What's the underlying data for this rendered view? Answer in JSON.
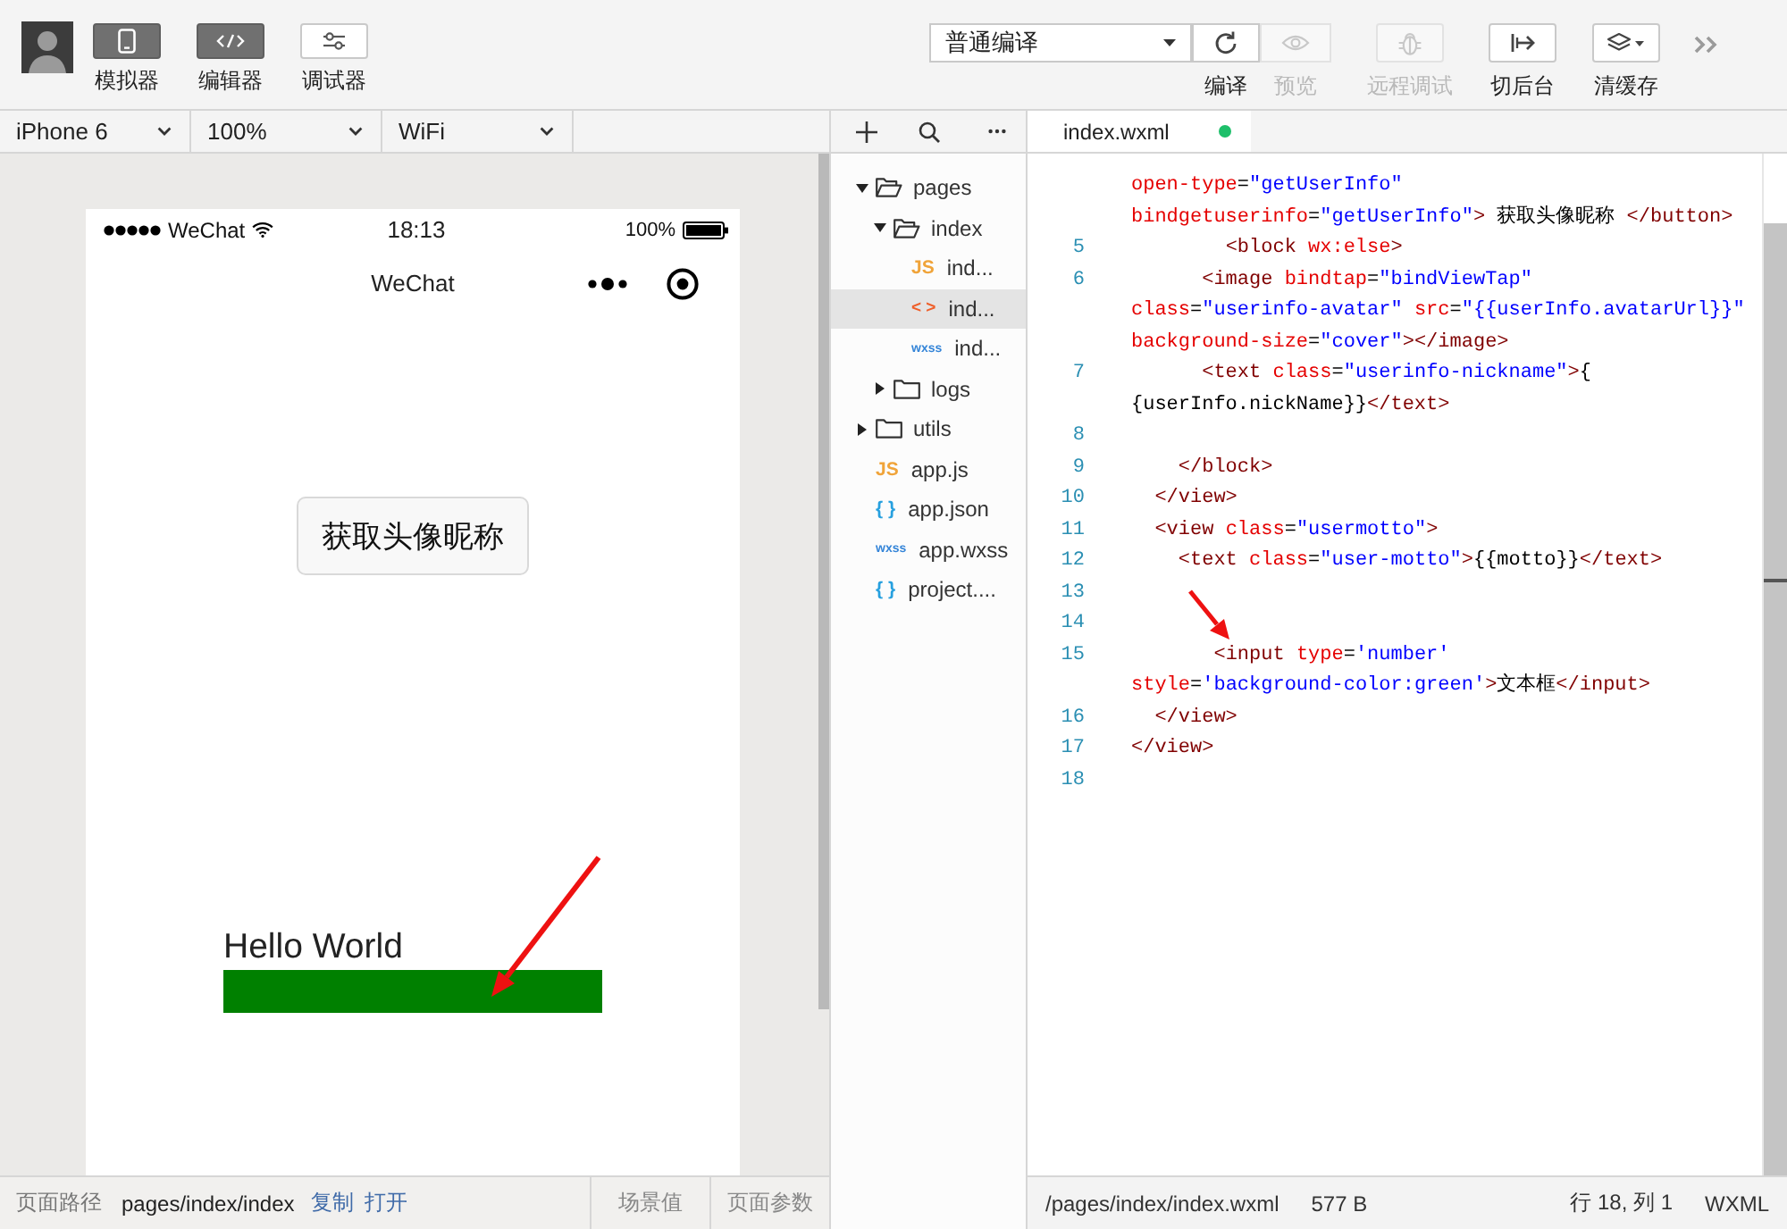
{
  "toolbar": {
    "views": [
      {
        "label": "模拟器",
        "selected": true
      },
      {
        "label": "编辑器",
        "selected": true
      },
      {
        "label": "调试器",
        "selected": false
      }
    ],
    "compile_mode": {
      "value": "普通编译"
    },
    "actions": [
      {
        "label": "编译",
        "disabled": false
      },
      {
        "label": "预览",
        "disabled": true
      },
      {
        "label": "远程调试",
        "disabled": true
      },
      {
        "label": "切后台",
        "disabled": false
      },
      {
        "label": "清缓存",
        "disabled": false
      }
    ]
  },
  "simulator": {
    "device_bar": [
      {
        "value": "iPhone 6"
      },
      {
        "value": "100%"
      },
      {
        "value": "WiFi"
      }
    ],
    "phone": {
      "carrier": "WeChat",
      "time": "18:13",
      "battery": "100%",
      "title": "WeChat",
      "button": "获取头像昵称",
      "motto": "Hello World"
    }
  },
  "file_tree": [
    {
      "kind": "folder",
      "name": "pages",
      "expanded": true,
      "selected": false,
      "children": [
        {
          "kind": "folder",
          "name": "index",
          "expanded": true,
          "selected": false,
          "children": [
            {
              "kind": "js",
              "badge": "JS",
              "name": "ind...",
              "selected": false
            },
            {
              "kind": "wxml",
              "badge": "< >",
              "name": "ind...",
              "selected": true
            },
            {
              "kind": "wxss",
              "badge": "wxss",
              "name": "ind...",
              "selected": false
            }
          ]
        },
        {
          "kind": "folder",
          "name": "logs",
          "expanded": false,
          "selected": false
        }
      ]
    },
    {
      "kind": "folder",
      "name": "utils",
      "expanded": false,
      "selected": false
    },
    {
      "kind": "js",
      "badge": "JS",
      "name": "app.js",
      "selected": false
    },
    {
      "kind": "json",
      "badge": "{ }",
      "name": "app.json",
      "selected": false
    },
    {
      "kind": "wxss",
      "badge": "wxss",
      "name": "app.wxss",
      "selected": false
    },
    {
      "kind": "json",
      "badge": "{ }",
      "name": "project....",
      "selected": false
    }
  ],
  "editor": {
    "tab": {
      "label": "index.wxml",
      "selected": true,
      "modified": true
    },
    "lines": [
      {
        "tokens": [
          {
            "kind": "attr",
            "text": "open-type"
          },
          {
            "kind": "op",
            "text": "="
          },
          {
            "kind": "str",
            "text": "\"getUserInfo\""
          }
        ]
      },
      {
        "tokens": [
          {
            "kind": "attr",
            "text": "bindgetuserinfo"
          },
          {
            "kind": "op",
            "text": "="
          },
          {
            "kind": "str",
            "text": "\"getUserInfo\""
          },
          {
            "kind": "tag",
            "text": "> "
          },
          {
            "kind": "text",
            "text": "获取头像昵称 "
          },
          {
            "kind": "tag",
            "text": "</button>"
          }
        ]
      },
      {
        "number": "5",
        "tokens": [
          {
            "kind": "tag",
            "text": "        <block "
          },
          {
            "kind": "attr",
            "text": "wx:else"
          },
          {
            "kind": "tag",
            "text": ">"
          }
        ]
      },
      {
        "number": "6",
        "tokens": [
          {
            "kind": "tag",
            "text": "      <image "
          },
          {
            "kind": "attr",
            "text": "bindtap"
          },
          {
            "kind": "op",
            "text": "="
          },
          {
            "kind": "str",
            "text": "\"bindViewTap\""
          }
        ]
      },
      {
        "tokens": [
          {
            "kind": "attr",
            "text": "class"
          },
          {
            "kind": "op",
            "text": "="
          },
          {
            "kind": "str",
            "text": "\"userinfo-avatar\" "
          },
          {
            "kind": "attr",
            "text": "src"
          },
          {
            "kind": "op",
            "text": "="
          },
          {
            "kind": "str",
            "text": "\"{{userInfo.avatarUrl}}\""
          }
        ]
      },
      {
        "tokens": [
          {
            "kind": "attr",
            "text": "background-size"
          },
          {
            "kind": "op",
            "text": "="
          },
          {
            "kind": "str",
            "text": "\"cover\""
          },
          {
            "kind": "tag",
            "text": "></image>"
          }
        ]
      },
      {
        "number": "7",
        "tokens": [
          {
            "kind": "tag",
            "text": "      <text "
          },
          {
            "kind": "attr",
            "text": "class"
          },
          {
            "kind": "op",
            "text": "="
          },
          {
            "kind": "str",
            "text": "\"userinfo-nickname\""
          },
          {
            "kind": "tag",
            "text": ">"
          },
          {
            "kind": "text",
            "text": "{"
          }
        ]
      },
      {
        "tokens": [
          {
            "kind": "text",
            "text": "{userInfo.nickName}}"
          },
          {
            "kind": "tag",
            "text": "</text>"
          }
        ]
      },
      {
        "number": "8"
      },
      {
        "number": "9",
        "tokens": [
          {
            "kind": "tag",
            "text": "    </block>"
          }
        ]
      },
      {
        "number": "10",
        "tokens": [
          {
            "kind": "tag",
            "text": "  </view>"
          }
        ]
      },
      {
        "number": "11",
        "tokens": [
          {
            "kind": "tag",
            "text": "  <view "
          },
          {
            "kind": "attr",
            "text": "class"
          },
          {
            "kind": "op",
            "text": "="
          },
          {
            "kind": "str",
            "text": "\"usermotto\""
          },
          {
            "kind": "tag",
            "text": ">"
          }
        ]
      },
      {
        "number": "12",
        "tokens": [
          {
            "kind": "tag",
            "text": "    <text "
          },
          {
            "kind": "attr",
            "text": "class"
          },
          {
            "kind": "op",
            "text": "="
          },
          {
            "kind": "str",
            "text": "\"user-motto\""
          },
          {
            "kind": "tag",
            "text": ">"
          },
          {
            "kind": "text",
            "text": "{{motto}}"
          },
          {
            "kind": "tag",
            "text": "</text>"
          }
        ]
      },
      {
        "number": "13"
      },
      {
        "number": "14"
      },
      {
        "number": "15",
        "tokens": [
          {
            "kind": "tag",
            "text": "       <input "
          },
          {
            "kind": "attr",
            "text": "type"
          },
          {
            "kind": "op",
            "text": "="
          },
          {
            "kind": "str",
            "text": "'number'"
          }
        ]
      },
      {
        "tokens": [
          {
            "kind": "attr",
            "text": "style"
          },
          {
            "kind": "op",
            "text": "="
          },
          {
            "kind": "str",
            "text": "'background-color:green'"
          },
          {
            "kind": "tag",
            "text": ">"
          },
          {
            "kind": "text",
            "text": "文本框"
          },
          {
            "kind": "tag",
            "text": "</input>"
          }
        ]
      },
      {
        "number": "16",
        "tokens": [
          {
            "kind": "tag",
            "text": "  </view>"
          }
        ]
      },
      {
        "number": "17",
        "tokens": [
          {
            "kind": "tag",
            "text": "</view>"
          }
        ]
      },
      {
        "number": "18"
      }
    ]
  },
  "status_bar": {
    "path_label": "页面路径",
    "path": "pages/index/index",
    "links": [
      "复制",
      "打开"
    ],
    "buttons": [
      "场景值",
      "页面参数"
    ],
    "file": "/pages/index/index.wxml",
    "size": "577 B",
    "cursor": "行 18, 列 1",
    "language": "WXML"
  }
}
